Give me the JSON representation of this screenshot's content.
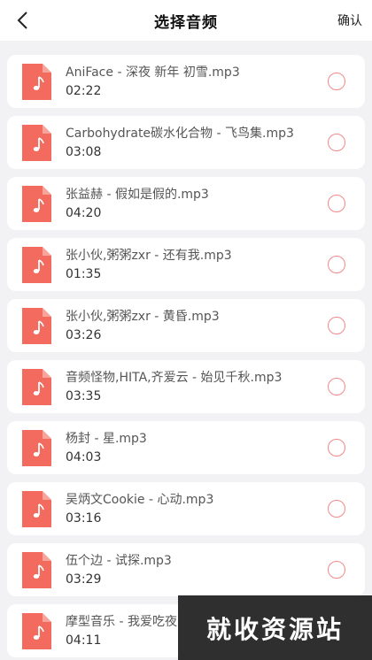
{
  "header": {
    "title": "选择音频",
    "confirm_label": "确认"
  },
  "colors": {
    "accent": "#f26b5e",
    "radio_border": "#f08a8a"
  },
  "items": [
    {
      "name": "AniFace - 深夜 新年 初雪.mp3",
      "duration": "02:22"
    },
    {
      "name": "Carbohydrate碳水化合物 - 飞鸟集.mp3",
      "duration": "03:08"
    },
    {
      "name": "张益赫 - 假如是假的.mp3",
      "duration": "04:20"
    },
    {
      "name": "张小伙,粥粥zxr - 还有我.mp3",
      "duration": "01:35"
    },
    {
      "name": "张小伙,粥粥zxr - 黄昏.mp3",
      "duration": "03:26"
    },
    {
      "name": "音频怪物,HITA,齐爱云 - 始见千秋.mp3",
      "duration": "03:35"
    },
    {
      "name": "杨封 - 星.mp3",
      "duration": "04:03"
    },
    {
      "name": "吴炳文Cookie - 心动.mp3",
      "duration": "03:16"
    },
    {
      "name": "伍个边 - 试探.mp3",
      "duration": "03:29"
    },
    {
      "name": "摩型音乐 - 我爱吃夜",
      "duration": "04:11"
    }
  ],
  "watermark": "就收资源站"
}
